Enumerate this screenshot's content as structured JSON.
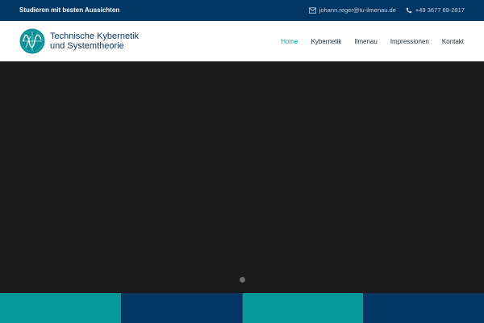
{
  "topbar": {
    "tagline": "Studieren mit besten Aussichten",
    "email": "johann.reger@tu-ilmenau.de",
    "phone": "+49 3677 69-2817",
    "email_icon": "envelope-icon",
    "phone_icon": "phone-icon"
  },
  "header": {
    "logo_line1": "Technische Kybernetik",
    "logo_line2": "und Systemtheorie",
    "logo_icon": "sine-wave-logo-icon"
  },
  "nav": {
    "items": [
      {
        "label": "Home",
        "active": true
      },
      {
        "label": "Kybernetik",
        "active": false
      },
      {
        "label": "Ilmenau",
        "active": false
      },
      {
        "label": "Impressionen",
        "active": false
      },
      {
        "label": "Kontakt",
        "active": false
      }
    ]
  },
  "hero": {
    "slider_dots": 1,
    "active_dot": 1
  },
  "colors": {
    "topbar_bg": "#043664",
    "accent_teal": "#089a99",
    "nav_active": "#06a3a0",
    "navy": "#043664",
    "hero_bg": "#1b1b1b"
  }
}
